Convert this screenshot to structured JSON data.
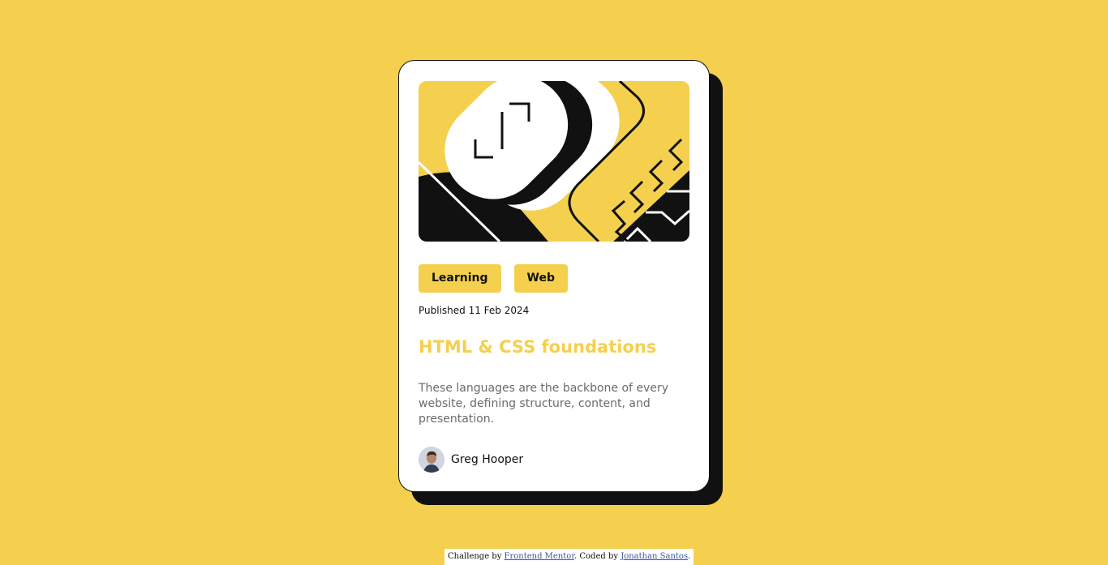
{
  "card": {
    "tags": [
      "Learning",
      "Web"
    ],
    "published": "Published 11 Feb 2024",
    "title": "HTML & CSS foundations",
    "description": "These languages are the backbone of every website, defining structure, content, and presentation.",
    "author": {
      "name": "Greg Hooper"
    }
  },
  "attribution": {
    "prefix": "Challenge by",
    "challenge_link": "Frontend Mentor",
    "middle": ". Coded by",
    "author_link": "Jonathan Santos",
    "suffix": "."
  },
  "colors": {
    "background": "#f4d04e",
    "card": "#ffffff",
    "shadow": "#111111",
    "title": "#f4d04e",
    "description": "#6b6b6b"
  },
  "icons": {
    "hero": "abstract-illustration",
    "avatar": "person-avatar"
  }
}
